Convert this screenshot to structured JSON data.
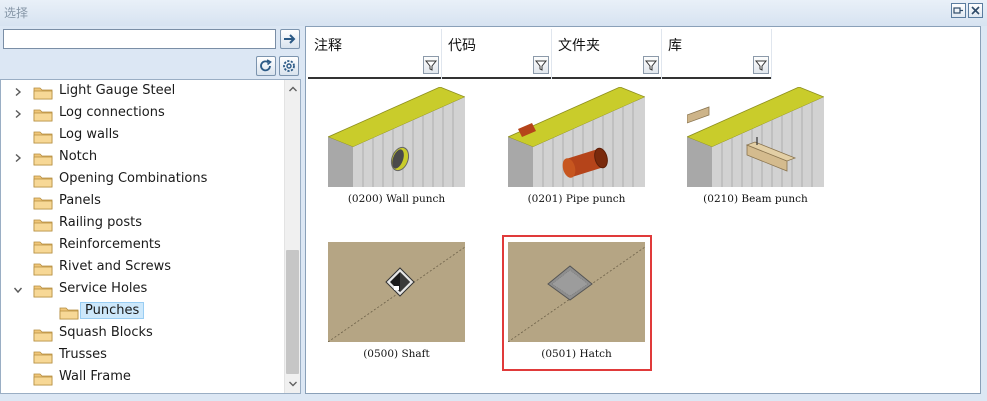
{
  "window": {
    "title": "选择"
  },
  "search": {
    "value": "",
    "placeholder": ""
  },
  "tree": {
    "items": [
      {
        "label": "Light Gauge Steel",
        "expandable": true,
        "expanded": false
      },
      {
        "label": "Log connections",
        "expandable": true,
        "expanded": false
      },
      {
        "label": "Log walls",
        "expandable": false,
        "expanded": false
      },
      {
        "label": "Notch",
        "expandable": true,
        "expanded": false
      },
      {
        "label": "Opening Combinations",
        "expandable": false,
        "expanded": false
      },
      {
        "label": "Panels",
        "expandable": false,
        "expanded": false
      },
      {
        "label": "Railing posts",
        "expandable": false,
        "expanded": false
      },
      {
        "label": "Reinforcements",
        "expandable": false,
        "expanded": false
      },
      {
        "label": "Rivet and Screws",
        "expandable": false,
        "expanded": false
      },
      {
        "label": "Service Holes",
        "expandable": true,
        "expanded": true
      },
      {
        "label": "Punches",
        "expandable": false,
        "expanded": false,
        "child": true,
        "selected": true
      },
      {
        "label": "Squash Blocks",
        "expandable": false,
        "expanded": false
      },
      {
        "label": "Trusses",
        "expandable": false,
        "expanded": false
      },
      {
        "label": "Wall Frame",
        "expandable": false,
        "expanded": false
      }
    ]
  },
  "columns": [
    {
      "label": "注释"
    },
    {
      "label": "代码"
    },
    {
      "label": "文件夹"
    },
    {
      "label": "库"
    }
  ],
  "items": [
    {
      "caption": "(0200) Wall punch",
      "kind": "wall-punch"
    },
    {
      "caption": "(0201) Pipe punch",
      "kind": "pipe-punch"
    },
    {
      "caption": "(0210) Beam punch",
      "kind": "beam-punch"
    },
    {
      "caption": "(0500) Shaft",
      "kind": "shaft"
    },
    {
      "caption": "(0501) Hatch",
      "kind": "hatch",
      "highlighted": true
    }
  ],
  "colors": {
    "selection": "#cde8fb",
    "highlight_border": "#e03a3a",
    "folder": "#f0c77a",
    "wall_top": "#c9cc2b",
    "floor": "#b5a584"
  }
}
